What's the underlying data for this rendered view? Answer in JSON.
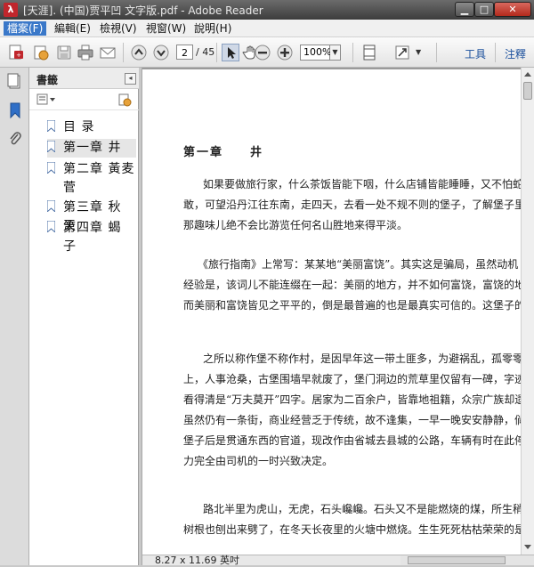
{
  "window": {
    "title": "[天涯]. (中国)贾平凹 文字版.pdf - Adobe Reader",
    "app_icon": "adobe-reader-icon",
    "buttons": [
      "minimize",
      "maximize",
      "close"
    ]
  },
  "menu": [
    {
      "label": "檔案(F)",
      "active": true
    },
    {
      "label": "編輯(E)",
      "active": false
    },
    {
      "label": "檢視(V)",
      "active": false
    },
    {
      "label": "視窗(W)",
      "active": false
    },
    {
      "label": "說明(H)",
      "active": false
    }
  ],
  "toolbar": {
    "page_current": "2",
    "page_total": "/ 45",
    "zoom": "100%",
    "tools_label": "工具",
    "comment_label": "注釋",
    "icons": [
      "create-pdf-icon",
      "convert-icon",
      "save-icon",
      "print-icon",
      "email-icon",
      "prev-page-icon",
      "next-page-icon",
      "select-cursor-icon",
      "hand-icon",
      "zoom-out-icon",
      "zoom-in-icon",
      "fit-page-icon",
      "fullscreen-icon"
    ]
  },
  "left_rail": {
    "icons": [
      "page-thumbnails-icon",
      "bookmarks-icon",
      "attachments-icon"
    ]
  },
  "bookmarks_panel": {
    "title": "書籤",
    "items": [
      {
        "label": "目 录",
        "selected": false
      },
      {
        "label": "第一章 井",
        "selected": true
      },
      {
        "label": "第二章 黃麦 菅",
        "selected": false
      },
      {
        "label": "第三章 秋 天",
        "selected": false
      },
      {
        "label": "第四章 蝎 子",
        "selected": false
      }
    ]
  },
  "document": {
    "chapter_title": "第一章　　井",
    "paragraphs": [
      [
        "　　如果要做旅行家，什么茶饭皆能下咽，什么店铺皆能睡睡，又不怕蛇，",
        "敢，可望沿丹江往东南，走四天，去看一处不规不则的堡子，了解堡子里一",
        "那趣味儿绝不会比游览任何名山胜地来得平淡。"
      ],
      [
        "　　《旅行指南》上常写：某某地“美丽富饶”。其实这是骗局，虽然动机",
        "经验是，该词儿不能连缀在一起：美丽的地方，并不如何富饶，富饶的地方，",
        "而美丽和富饶皆见之平平的，倒是最普遍的也是最真实可信的。这堡子的情"
      ],
      [
        "　　之所以称作堡不称作村，是因早年这一带土匪多，为避祸乱，孤零零堆",
        "上，人事沧桑，古堡围墙早就废了，堡门洞边的荒草里仅留有一碑，字迹斑驳",
        "看得清是“万夫莫开”四字。居家为二百余户，皆靠地祖籍，众宗广族却遗憾",
        "虽然仍有一条街，商业经营乏于传统，故不逢集，一早一晚安安静静，倘有",
        "堡子后是贯通东西的官道，现改作由省城去县城的公路，车辆有时在此停留",
        "力完全由司机的一时兴致决定。"
      ],
      [
        "　　路北半里为虎山，无虎，石头巉巉。石头又不是能燃烧的煤，所生稍林",
        "树根也刨出来劈了，在冬天长夜里的火塘中燃烧。生生死死枯枯荣荣的是一"
      ]
    ]
  },
  "status": {
    "page_size": "8.27 x 11.69 英吋"
  }
}
